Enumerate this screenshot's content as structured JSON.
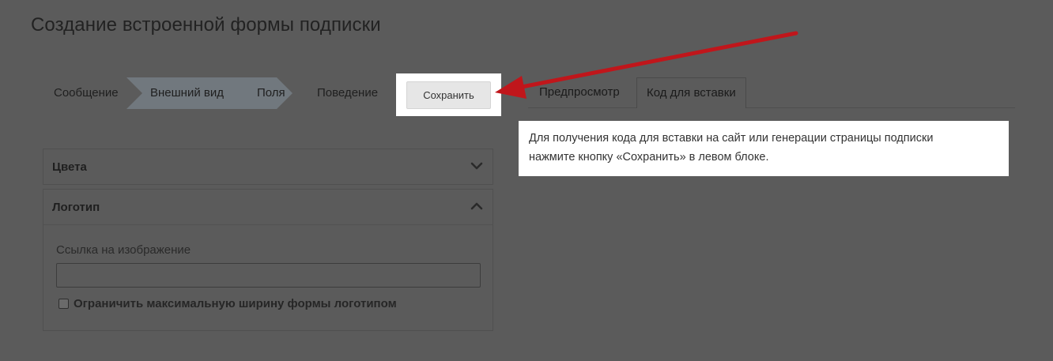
{
  "page": {
    "title": "Создание встроенной формы подписки"
  },
  "steps": [
    {
      "label": "Сообщение",
      "active": false
    },
    {
      "label": "Внешний вид",
      "active": true
    },
    {
      "label": "Поля",
      "active": false
    },
    {
      "label": "Поведение",
      "active": false
    }
  ],
  "toolbar": {
    "save_label": "Сохранить"
  },
  "tabs": [
    {
      "label": "Предпросмотр",
      "active": false
    },
    {
      "label": "Код для вставки",
      "active": true
    }
  ],
  "info": {
    "line1": "Для получения кода для вставки на сайт или генерации страницы подписки",
    "line2": "нажмите кнопку «Сохранить» в левом блоке."
  },
  "panels": {
    "colors": {
      "title": "Цвета",
      "expanded": false,
      "icon": "chevron-down-icon"
    },
    "logo": {
      "title": "Логотип",
      "expanded": true,
      "icon": "chevron-up-icon",
      "image_link_label": "Ссылка на изображение",
      "image_link_value": "",
      "limit_width_label": "Ограничить максимальную ширину формы логотипом",
      "limit_width_checked": false
    }
  },
  "colors": {
    "overlay": "#5b5b5b",
    "active_step": "#71787e",
    "annotation_arrow": "#c0161b",
    "highlight": "#ffffff"
  }
}
